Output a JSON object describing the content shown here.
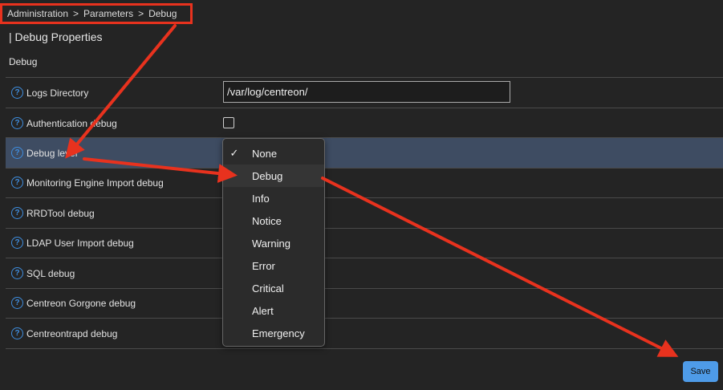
{
  "breadcrumb": {
    "items": [
      "Administration",
      "Parameters",
      "Debug"
    ],
    "separator": ">"
  },
  "page": {
    "title": "| Debug Properties",
    "section": "Debug"
  },
  "rows": [
    {
      "label": "Logs Directory"
    },
    {
      "label": "Authentication debug"
    },
    {
      "label": "Debug level"
    },
    {
      "label": "Monitoring Engine Import debug"
    },
    {
      "label": "RRDTool debug"
    },
    {
      "label": "LDAP User Import debug"
    },
    {
      "label": "SQL debug"
    },
    {
      "label": "Centreon Gorgone debug"
    },
    {
      "label": "Centreontrapd debug"
    }
  ],
  "logs_directory": {
    "value": "/var/log/centreon/"
  },
  "authentication_debug": {
    "checked": false
  },
  "debug_level": {
    "selected": "None",
    "hovered": "Debug",
    "checkmark": "✓",
    "options": [
      "None",
      "Debug",
      "Info",
      "Notice",
      "Warning",
      "Error",
      "Critical",
      "Alert",
      "Emergency"
    ]
  },
  "actions": {
    "save_label": "Save"
  },
  "colors": {
    "accent": "#4e9be8",
    "annotation": "#e8321e",
    "highlight": "#3e4c62",
    "help_icon": "#3f8dde"
  },
  "icons": {
    "help": "question-circle-icon",
    "check": "checkmark-icon"
  }
}
